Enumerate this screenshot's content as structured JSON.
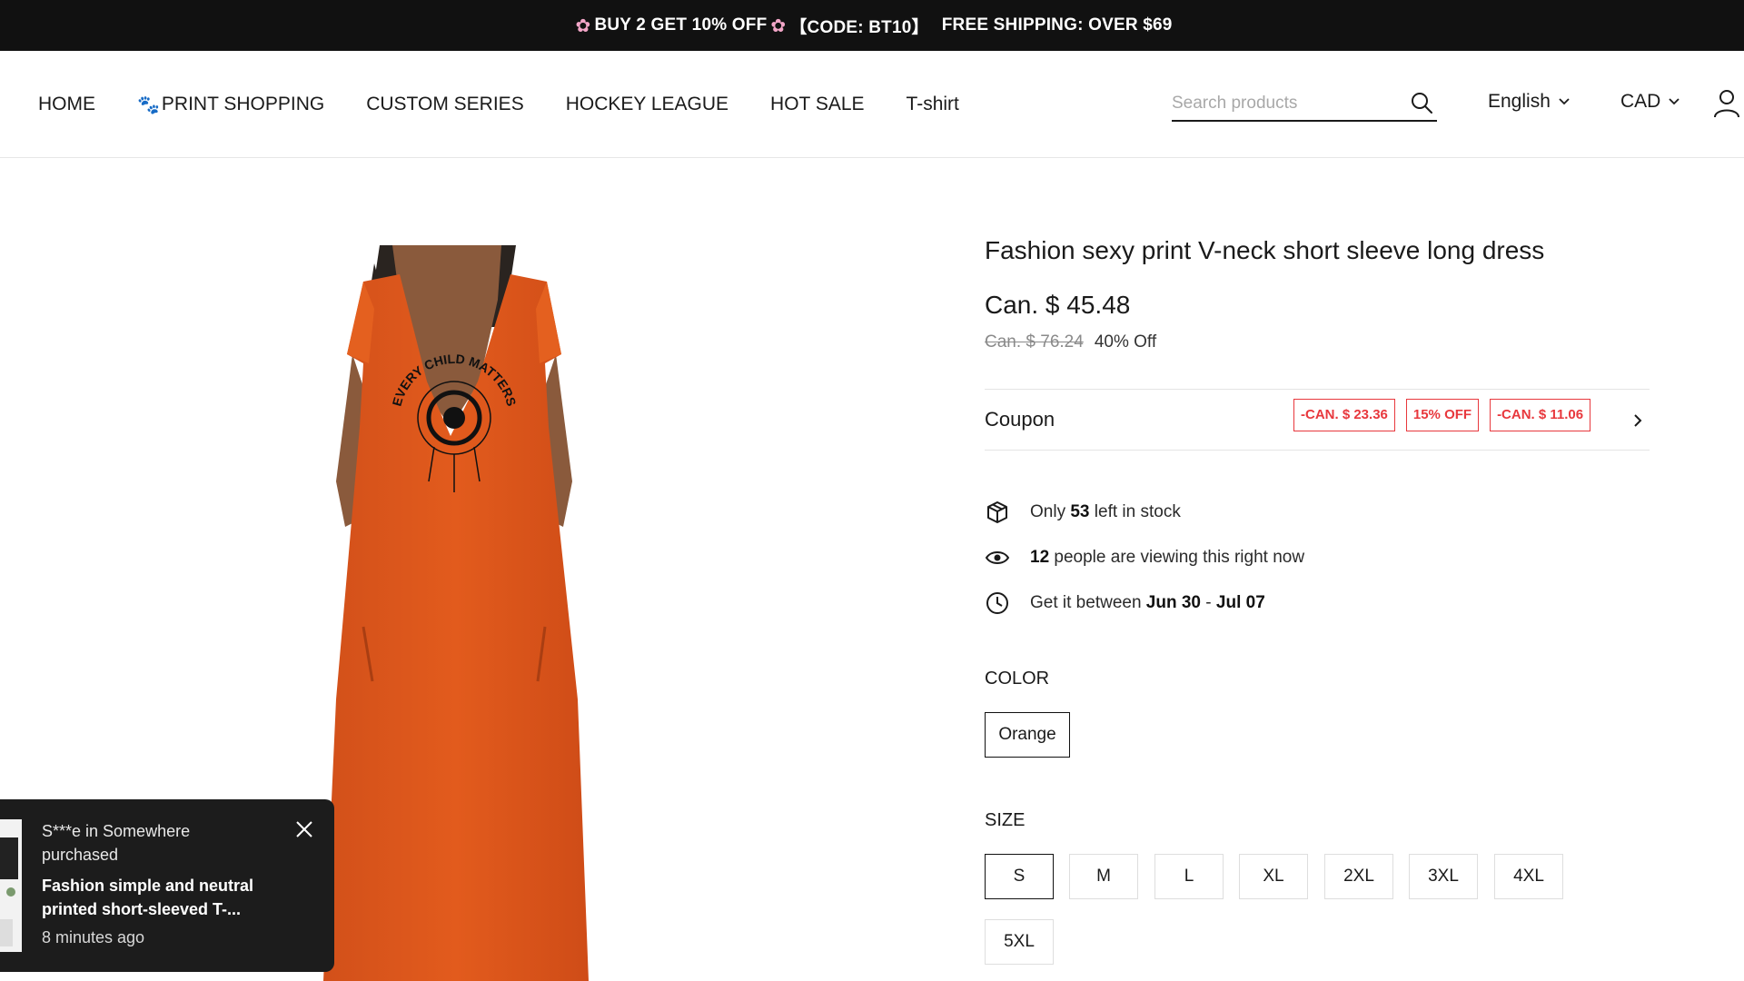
{
  "promo": {
    "left_text": "BUY 2 GET 10% OFF",
    "code_text": "【CODE: BT10】",
    "shipping_text": "FREE SHIPPING: OVER $69",
    "flower_icon": "flower-icon"
  },
  "nav": {
    "items": [
      {
        "label": "HOME"
      },
      {
        "label": "PRINT SHOPPING",
        "icon": "paw-icon"
      },
      {
        "label": "CUSTOM SERIES"
      },
      {
        "label": "HOCKEY LEAGUE"
      },
      {
        "label": "HOT SALE"
      },
      {
        "label": "T-shirt"
      }
    ],
    "search_placeholder": "Search products",
    "search_value": "",
    "language": "English",
    "currency": "CAD"
  },
  "product": {
    "title": "Fashion sexy print V-neck short sleeve long dress",
    "price": "Can. $ 45.48",
    "old_price": "Can. $ 76.24",
    "discount": "40% Off",
    "image_color": "#e2591c",
    "print_text": "EVERY CHILD MATTERS",
    "coupon": {
      "label": "Coupon",
      "tags": [
        "-CAN. $ 23.36",
        "15% OFF",
        "-CAN. $ 11.06"
      ],
      "tag_color": "#e8383d"
    },
    "stock": {
      "prefix": "Only ",
      "count": "53",
      "suffix": " left in stock"
    },
    "viewers": {
      "count": "12",
      "suffix": " people are viewing this right now"
    },
    "delivery": {
      "prefix": "Get it between ",
      "start": "Jun 30",
      "sep": " - ",
      "end": "Jul 07"
    },
    "color_label": "COLOR",
    "colors": [
      "Orange"
    ],
    "selected_color": "Orange",
    "size_label": "SIZE",
    "sizes": [
      "S",
      "M",
      "L",
      "XL",
      "2XL",
      "3XL",
      "4XL",
      "5XL"
    ],
    "selected_size": "S"
  },
  "toast": {
    "line1": "S***e in Somewhere purchased",
    "line2": "Fashion simple and neutral printed short-sleeved T-...",
    "time": "8 minutes ago"
  }
}
